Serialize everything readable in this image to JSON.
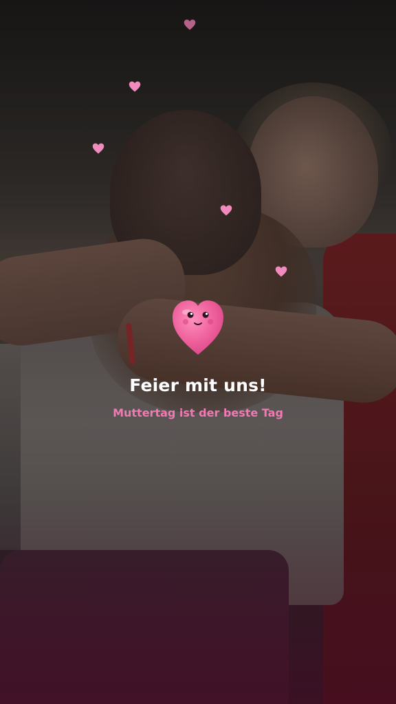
{
  "story": {
    "headline": "Feier mit uns!",
    "subline": "Muttertag ist der beste Tag"
  },
  "decor": {
    "heart_color": "#f28bbd",
    "mascot_color": "#ee5f9b",
    "accent_text_color": "#f07ab2",
    "icons": [
      "heart-icon",
      "heart-mascot-icon"
    ]
  }
}
